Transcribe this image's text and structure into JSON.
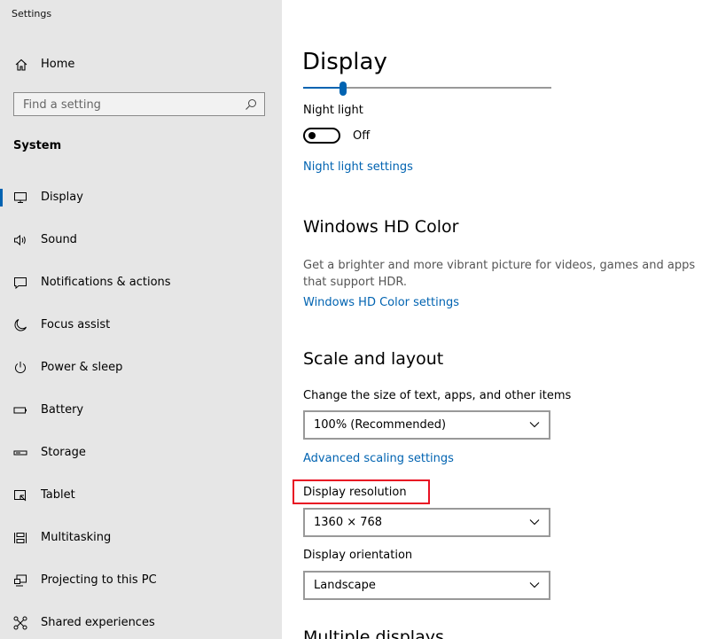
{
  "app": {
    "title": "Settings"
  },
  "sidebar": {
    "home_label": "Home",
    "search_placeholder": "Find a setting",
    "section_header": "System",
    "items": [
      {
        "label": "Display",
        "icon": "monitor-icon",
        "active": true
      },
      {
        "label": "Sound",
        "icon": "speaker-icon"
      },
      {
        "label": "Notifications & actions",
        "icon": "notifications-icon"
      },
      {
        "label": "Focus assist",
        "icon": "moon-icon"
      },
      {
        "label": "Power & sleep",
        "icon": "power-icon"
      },
      {
        "label": "Battery",
        "icon": "battery-icon"
      },
      {
        "label": "Storage",
        "icon": "storage-icon"
      },
      {
        "label": "Tablet",
        "icon": "tablet-icon"
      },
      {
        "label": "Multitasking",
        "icon": "multitasking-icon"
      },
      {
        "label": "Projecting to this PC",
        "icon": "projecting-icon"
      },
      {
        "label": "Shared experiences",
        "icon": "shared-icon"
      }
    ]
  },
  "main": {
    "title": "Display",
    "brightness": {
      "value_fraction": 0.16
    },
    "night_light": {
      "label": "Night light",
      "state": "Off",
      "settings_link": "Night light settings"
    },
    "hd_color": {
      "heading": "Windows HD Color",
      "description": "Get a brighter and more vibrant picture for videos, games and apps that support HDR.",
      "settings_link": "Windows HD Color settings"
    },
    "scale_layout": {
      "heading": "Scale and layout",
      "scale_label": "Change the size of text, apps, and other items",
      "scale_value": "100% (Recommended)",
      "advanced_link": "Advanced scaling settings",
      "resolution_label": "Display resolution",
      "resolution_value": "1360 × 768",
      "orientation_label": "Display orientation",
      "orientation_value": "Landscape"
    },
    "multiple_displays_heading": "Multiple displays"
  },
  "colors": {
    "accent": "#0063b1",
    "highlight": "#e81123",
    "sidebar_bg": "#e6e6e6"
  }
}
